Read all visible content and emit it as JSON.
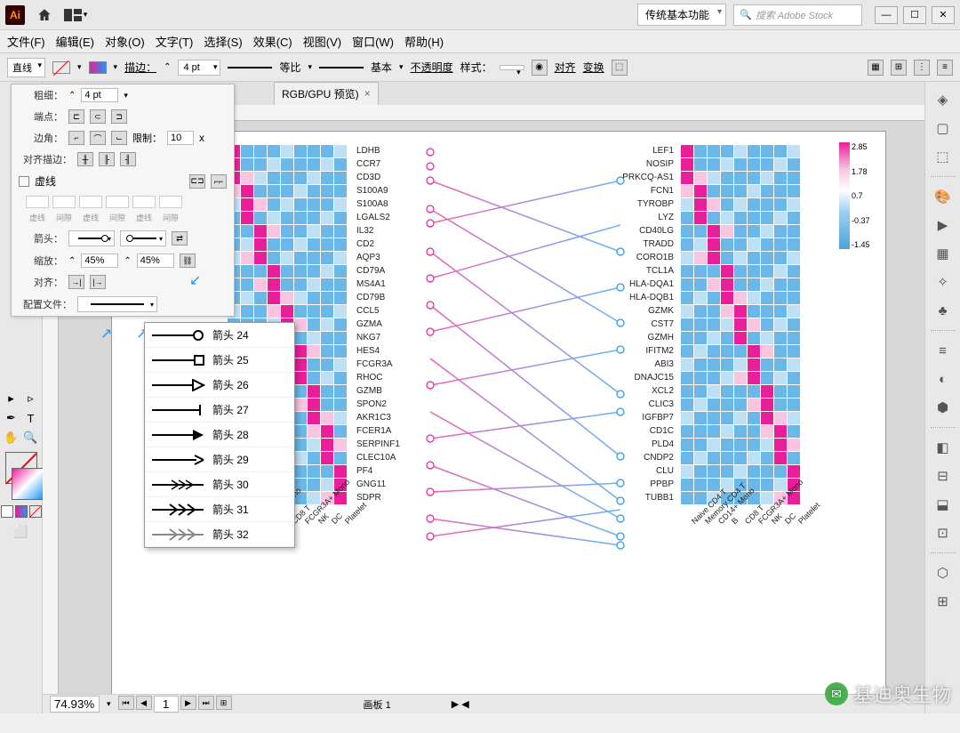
{
  "titlebar": {
    "app_abbr": "Ai",
    "workspace": "传统基本功能",
    "search_placeholder": "搜索 Adobe Stock"
  },
  "menus": [
    "文件(F)",
    "编辑(E)",
    "对象(O)",
    "文字(T)",
    "选择(S)",
    "效果(C)",
    "视图(V)",
    "窗口(W)",
    "帮助(H)"
  ],
  "control": {
    "shape": "直线",
    "stroke_label": "描边：",
    "stroke_w": "4 pt",
    "profile": "等比",
    "brush": "基本",
    "opacity_label": "不透明度",
    "style_label": "样式：",
    "align": "对齐",
    "transform": "变换"
  },
  "doc_tab": {
    "title": "RGB/GPU 预览)",
    "close": "×"
  },
  "stroke_panel": {
    "weight_label": "粗细：",
    "weight": "4 pt",
    "cap_label": "端点：",
    "join_label": "边角：",
    "limit_label": "限制：",
    "limit": "10",
    "limit_x": "x",
    "align_label": "对齐描边：",
    "dash_cb": "虚线",
    "dash_headers": [
      "虚线",
      "间隙",
      "虚线",
      "间隙",
      "虚线",
      "间隙"
    ],
    "arrow_label": "箭头：",
    "scale_label": "缩放：",
    "scale1": "45%",
    "scale2": "45%",
    "align2_label": "对齐：",
    "profile_label": "配置文件："
  },
  "arrow_popup": [
    {
      "label": "箭头 24",
      "type": "circle"
    },
    {
      "label": "箭头 25",
      "type": "square"
    },
    {
      "label": "箭头 26",
      "type": "tri-open"
    },
    {
      "label": "箭头 27",
      "type": "bar"
    },
    {
      "label": "箭头 28",
      "type": "arrow"
    },
    {
      "label": "箭头 29",
      "type": "arrow-open"
    },
    {
      "label": "箭头 30",
      "type": "feather"
    },
    {
      "label": "箭头 31",
      "type": "feather2"
    },
    {
      "label": "箭头 32",
      "type": "feather3"
    }
  ],
  "status": {
    "zoom": "74.93%",
    "artboard_no": "1",
    "artboard_label": "画板 1"
  },
  "chart_data": {
    "type": "heatmap",
    "left_genes": [
      "LDHB",
      "CCR7",
      "CD3D",
      "S100A9",
      "S100A8",
      "LGALS2",
      "IL32",
      "CD2",
      "AQP3",
      "CD79A",
      "MS4A1",
      "CD79B",
      "CCL5",
      "GZMA",
      "NKG7",
      "HES4",
      "FCGR3A",
      "RHOC",
      "GZMB",
      "SPON2",
      "AKR1C3",
      "FCER1A",
      "SERPINF1",
      "CLEC10A",
      "PF4",
      "GNG11",
      "SDPR"
    ],
    "right_genes": [
      "LEF1",
      "NOSIP",
      "PRKCQ-AS1",
      "FCN1",
      "TYROBP",
      "LYZ",
      "CD40LG",
      "TRADD",
      "CORO1B",
      "TCL1A",
      "HLA-DQA1",
      "HLA-DQB1",
      "GZMK",
      "CST7",
      "GZMH",
      "IFITM2",
      "ABI3",
      "DNAJC15",
      "XCL2",
      "CLIC3",
      "IGFBP7",
      "CD1C",
      "PLD4",
      "CNDP2",
      "CLU",
      "PPBP",
      "TUBB1"
    ],
    "columns": [
      "Naive CD4 T",
      "Memory CD4 T",
      "CD14+ Mono",
      "B",
      "CD8 T",
      "FCGR3A+ Mono",
      "NK",
      "DC",
      "Platelet"
    ],
    "legend_ticks": [
      "2.85",
      "1.78",
      "0.7",
      "-0.37",
      "-1.45"
    ]
  },
  "watermark": "基迪奥生物"
}
